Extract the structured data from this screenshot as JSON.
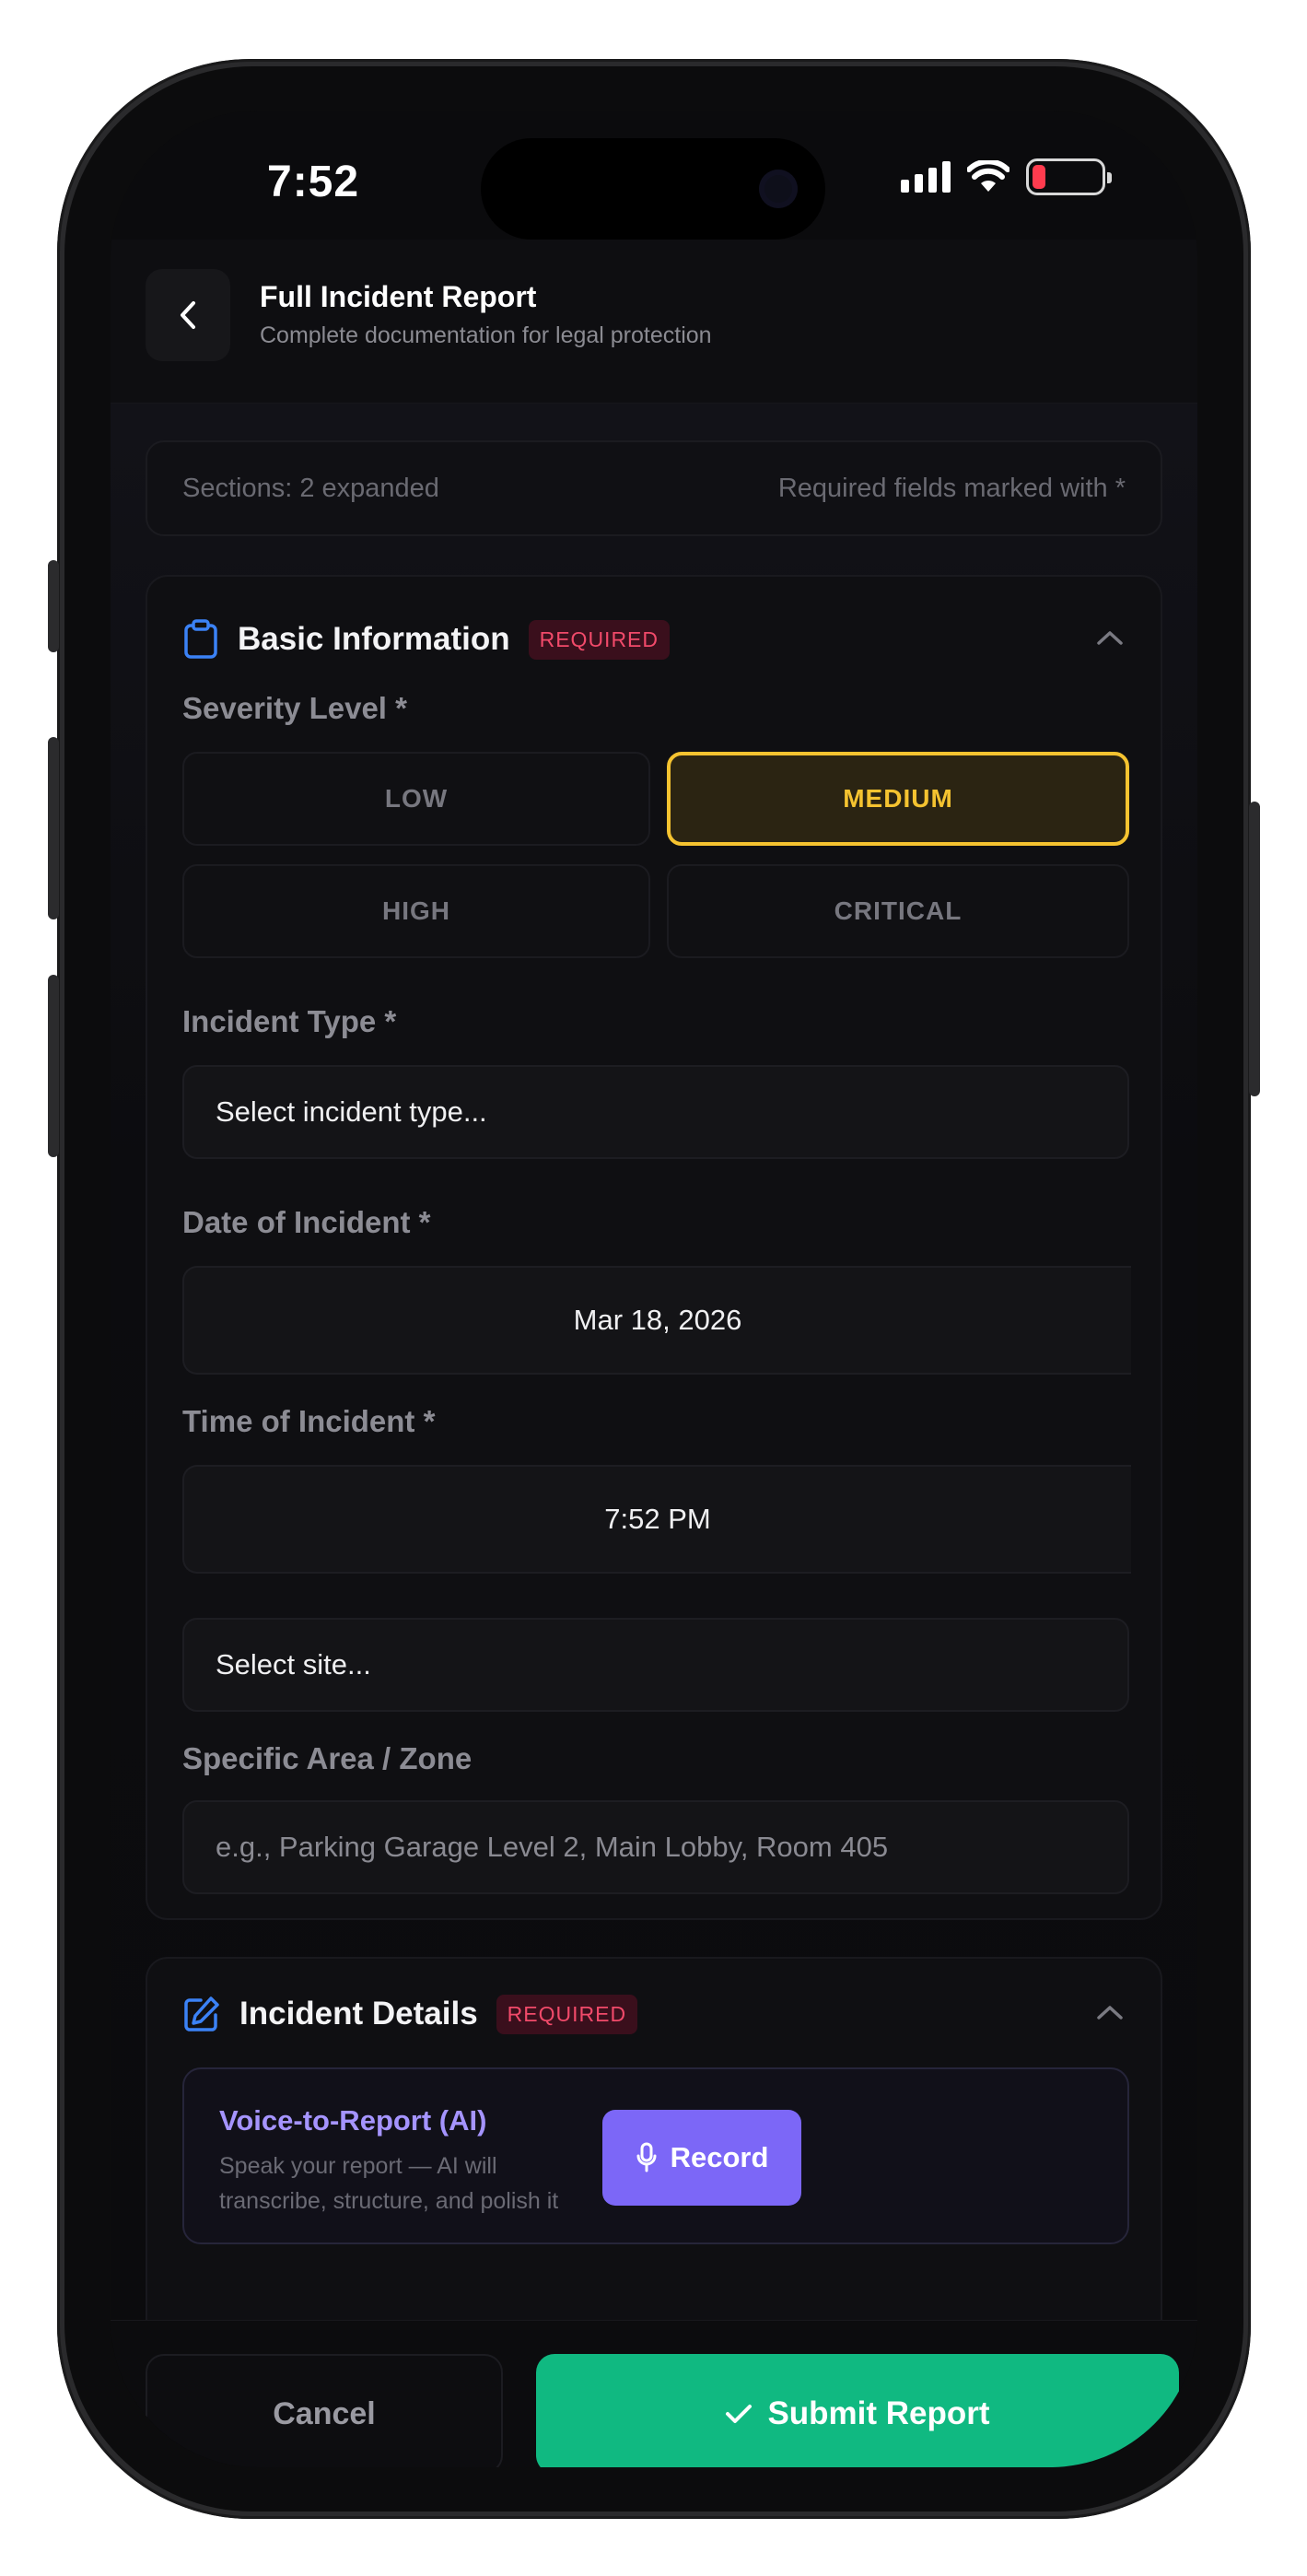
{
  "status_bar": {
    "time": "7:52"
  },
  "header": {
    "title": "Full Incident Report",
    "subtitle": "Complete documentation for legal protection"
  },
  "info_bar": {
    "sections_text": "Sections: 2 expanded",
    "required_text": "Required fields marked with *"
  },
  "basic_info": {
    "title": "Basic Information",
    "badge": "REQUIRED",
    "severity_label": "Severity Level *",
    "severity_options": [
      "LOW",
      "MEDIUM",
      "HIGH",
      "CRITICAL"
    ],
    "severity_selected": "MEDIUM",
    "incident_type_label": "Incident Type *",
    "incident_type_value": "Select incident type...",
    "date_label": "Date of Incident *",
    "date_value": "Mar 18, 2026",
    "time_label": "Time of Incident *",
    "time_value": "7:52 PM",
    "site_value": "Select site...",
    "area_label": "Specific Area / Zone",
    "area_placeholder": "e.g., Parking Garage Level 2, Main Lobby, Room 405"
  },
  "incident_details": {
    "title": "Incident Details",
    "badge": "REQUIRED",
    "voice_title": "Voice-to-Report (AI)",
    "voice_desc": "Speak your report — AI will transcribe, structure, and polish it",
    "record_label": "Record"
  },
  "footer": {
    "cancel_label": "Cancel",
    "submit_label": "Submit Report"
  },
  "colors": {
    "accent_blue": "#3b82f6",
    "selected_yellow": "#f5c330",
    "required_red": "#f14a6a",
    "record_purple": "#7c67f7",
    "submit_green": "#10b981"
  }
}
